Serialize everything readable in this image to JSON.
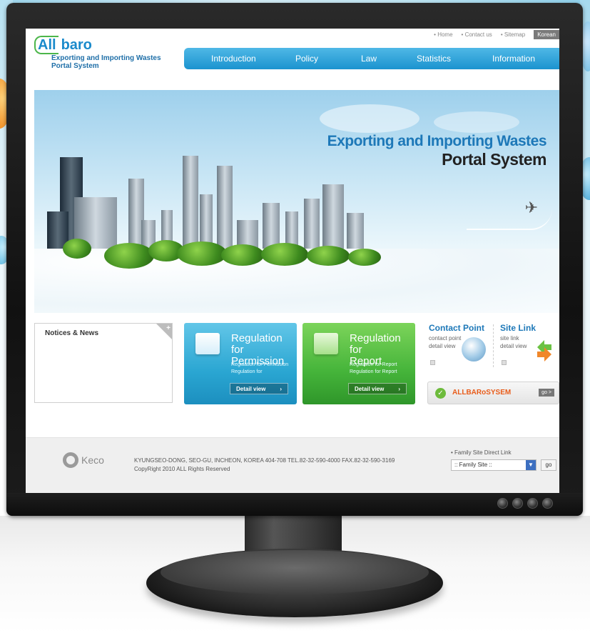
{
  "header": {
    "util_links": [
      "Home",
      "Contact us",
      "Sitemap"
    ],
    "language": "Korean",
    "logo_all": "All",
    "logo_baro": "baro",
    "logo_sub_1": "Exporting and Importing Wastes",
    "logo_sub_2": "Portal System"
  },
  "nav": {
    "items": [
      "Introduction",
      "Policy",
      "Law",
      "Statistics",
      "Information"
    ]
  },
  "banner": {
    "headline_1": "Exporting and Importing Wastes",
    "headline_2": "Portal System"
  },
  "notices": {
    "title": "Notices & News"
  },
  "permission": {
    "title_1": "Regulation for",
    "title_2": "Permission",
    "sub_1": "Regulation for Permission",
    "sub_2": "Regulation for",
    "button": "Detail view"
  },
  "report": {
    "title_1": "Regulation for",
    "title_2": "Report",
    "sub_1": "Regulation for Report",
    "sub_2": "Regulation for Report",
    "button": "Detail view"
  },
  "contact_point": {
    "title": "Contact Point",
    "sub_1": "contact point",
    "sub_2": "detail view"
  },
  "site_link": {
    "title": "Site Link",
    "sub_1": "site link",
    "sub_2": "detail view"
  },
  "allbaro_bar": {
    "label": "ALLBARoSYSEM",
    "go": "go >"
  },
  "footer": {
    "logo_text": "Keco",
    "address": "KYUNGSEO-DONG, SEO-GU, INCHEON, KOREA 404-708  TEL.82-32-590-4000  FAX.82-32-590-3169",
    "copyright": "CopyRight 2010 ALL Rights Reserved",
    "family_label": "• Family Site Direct Link",
    "family_select": ":: Family Site ::",
    "go": "go"
  },
  "colors": {
    "brand_blue": "#1d78b8",
    "nav_blue": "#1b93cf",
    "permission_blue": "#2aa6d2",
    "report_green": "#45b43a",
    "allbaro_orange": "#e85c1a"
  }
}
